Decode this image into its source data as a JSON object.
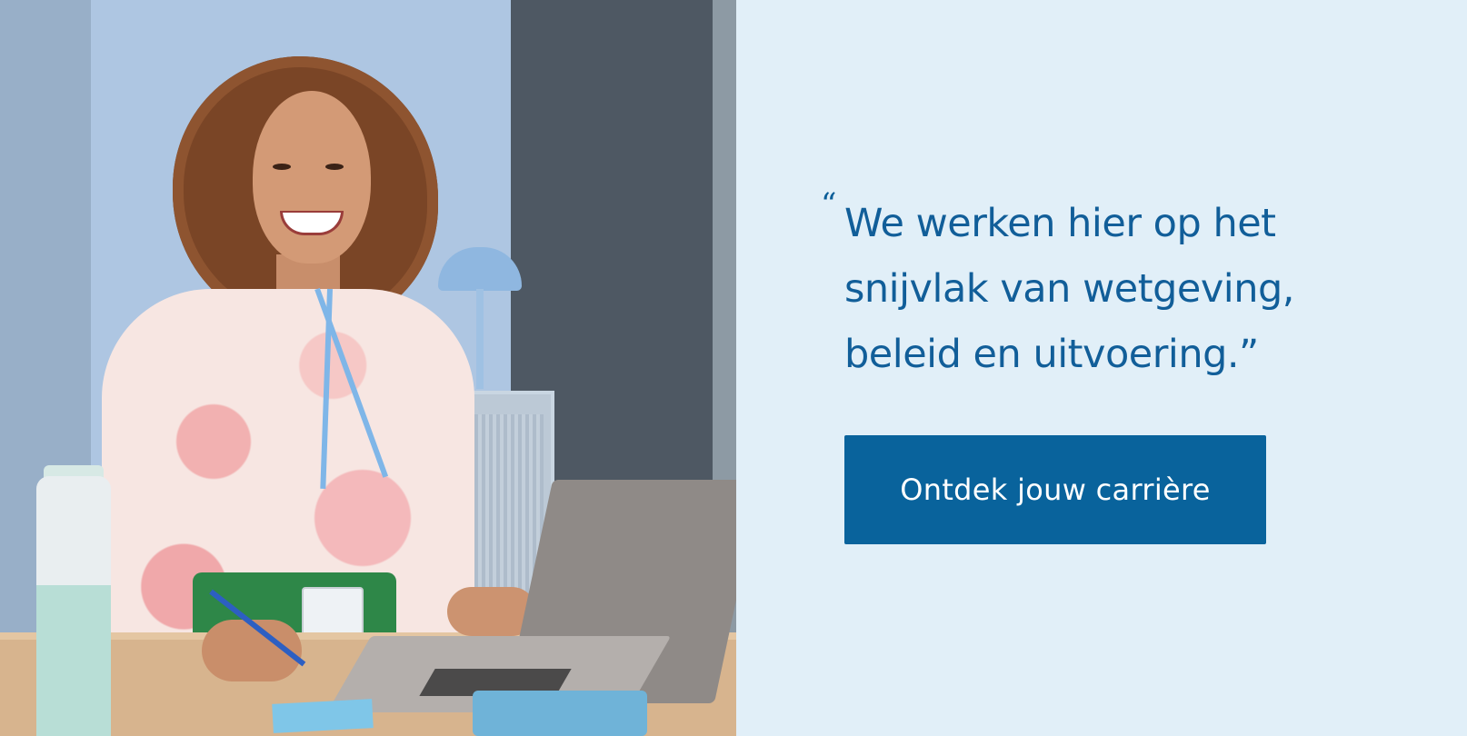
{
  "photo": {
    "icon": "portrait-photo",
    "subject_colors": {
      "wall": "#aec6e2",
      "desk": "#d7b48e",
      "blouse": "#f7e6e2",
      "skirt": "#2e8748"
    }
  },
  "quote": {
    "open_mark": "“",
    "text": "We werken hier op het snijvlak van wetgeving, beleid en uitvoering.”"
  },
  "cta": {
    "label": "Ontdek jouw carrière"
  },
  "colors": {
    "panel_background": "#e1eff8",
    "quote_text": "#115e99",
    "button_background": "#09639c",
    "button_text": "#ffffff"
  }
}
